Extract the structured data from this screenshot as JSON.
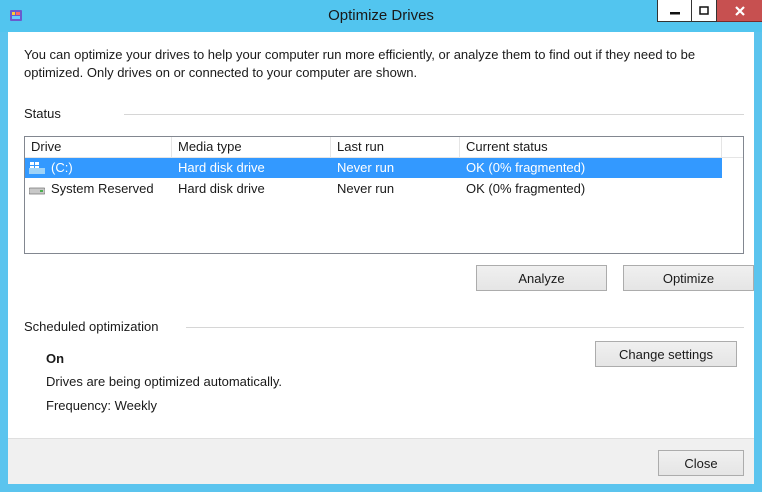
{
  "window": {
    "title": "Optimize Drives",
    "accent_color": "#52c5ef",
    "close_color": "#c75050"
  },
  "intro": {
    "text": "You can optimize your drives to help your computer run more efficiently, or analyze them to find out if they need to be optimized. Only drives on or connected to your computer are shown."
  },
  "status": {
    "heading": "Status",
    "columns": [
      "Drive",
      "Media type",
      "Last run",
      "Current status"
    ],
    "rows": [
      {
        "drive": "(C:)",
        "icon": "windows-drive-icon",
        "media_type": "Hard disk drive",
        "last_run": "Never run",
        "current_status": "OK (0% fragmented)",
        "selected": true
      },
      {
        "drive": "System Reserved",
        "icon": "hard-drive-icon",
        "media_type": "Hard disk drive",
        "last_run": "Never run",
        "current_status": "OK (0% fragmented)",
        "selected": false
      }
    ],
    "analyze_label": "Analyze",
    "optimize_label": "Optimize"
  },
  "scheduled": {
    "heading": "Scheduled optimization",
    "state": "On",
    "description": "Drives are being optimized automatically.",
    "frequency": "Frequency: Weekly",
    "change_settings_label": "Change settings"
  },
  "footer": {
    "close_label": "Close"
  }
}
